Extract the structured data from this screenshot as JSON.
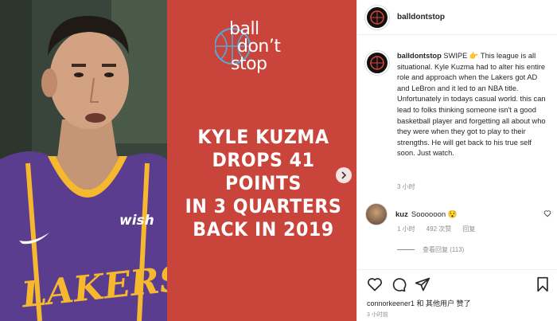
{
  "post_image": {
    "brand": {
      "line1": "ball",
      "line2": "don’t",
      "line3": "stop"
    },
    "headline": [
      "KYLE KUZMA",
      "DROPS 41 POINTS",
      "IN 3 QUARTERS",
      "BACK IN 2019"
    ],
    "jersey": {
      "sponsor": "wish",
      "team": "LAKERS"
    },
    "colors": {
      "graphic_bg": "#c9453b",
      "jersey": "#5b3d8f",
      "jersey_text": "#f5b82e"
    }
  },
  "header": {
    "username": "balldontstop"
  },
  "caption": {
    "username": "balldontstop",
    "text": "SWIPE 👉 This league is all situational. Kyle Kuzma had to alter his entire role and approach when the Lakers got AD and LeBron and it led to an NBA title. Unfortunately in todays casual world. this can lead to folks thinking someone isn't a good basketball player and forgetting all about who they were when they got to play to their strengths. He will get back to his true self soon. Just watch.",
    "time": "3 小时"
  },
  "comment": {
    "username": "kuz",
    "text": "Soooooon 😯",
    "time": "1 小时",
    "likes": "492 次赞",
    "reply": "回复",
    "view_replies": "查看回复 (113)"
  },
  "footer": {
    "likes_text": "connorkeener1 和 其他用户 赞了",
    "time": "3 小时前"
  },
  "icons": [
    "heart-icon",
    "comment-icon",
    "share-icon",
    "bookmark-icon",
    "chevron-right-icon"
  ]
}
